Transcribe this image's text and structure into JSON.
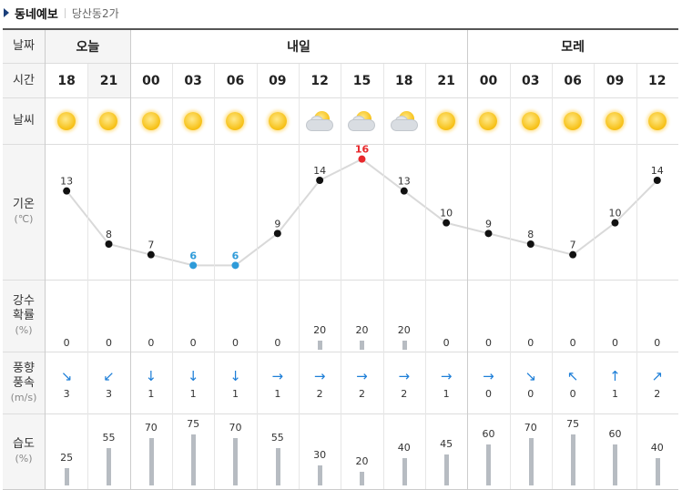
{
  "title": {
    "main": "동네예보",
    "sub": "당산동2가"
  },
  "labels": {
    "date": "날짜",
    "time": "시간",
    "weather": "날씨",
    "temp": "기온",
    "temp_unit": "(℃)",
    "precip": "강수\n확률",
    "precip_unit": "(%)",
    "wind": "풍향\n풍속",
    "wind_unit": "(m/s)",
    "humidity": "습도",
    "humidity_unit": "(%)"
  },
  "days": [
    {
      "label": "오늘",
      "span": 2
    },
    {
      "label": "내일",
      "span": 8
    },
    {
      "label": "모레",
      "span": 5
    }
  ],
  "times": [
    "18",
    "21",
    "00",
    "03",
    "06",
    "09",
    "12",
    "15",
    "18",
    "21",
    "00",
    "03",
    "06",
    "09",
    "12"
  ],
  "weather_icons": [
    "sunny",
    "sunny",
    "sunny",
    "sunny",
    "sunny",
    "sunny",
    "partly-cloudy",
    "partly-cloudy",
    "partly-cloudy",
    "sunny",
    "sunny",
    "sunny",
    "sunny",
    "sunny",
    "sunny"
  ],
  "chart_data": {
    "type": "line",
    "x": [
      "18",
      "21",
      "00",
      "03",
      "06",
      "09",
      "12",
      "15",
      "18",
      "21",
      "00",
      "03",
      "06",
      "09",
      "12"
    ],
    "series": [
      {
        "values": [
          13,
          8,
          7,
          6,
          6,
          9,
          14,
          16,
          13,
          10,
          9,
          8,
          7,
          10,
          14
        ]
      }
    ],
    "ylim": [
      5,
      17
    ],
    "max_color": "#e8282b",
    "min_color": "#2e9bd9"
  },
  "precip": [
    0,
    0,
    0,
    0,
    0,
    0,
    20,
    20,
    20,
    0,
    0,
    0,
    0,
    0,
    0
  ],
  "wind": {
    "icons": [
      "arrow-down-right",
      "arrow-down-left",
      "arrow-down",
      "arrow-down",
      "arrow-down",
      "arrow-right",
      "arrow-right",
      "arrow-right",
      "arrow-right",
      "arrow-right",
      "arrow-right",
      "arrow-down-right",
      "arrow-up-left",
      "arrow-up",
      "arrow-up-right"
    ],
    "speed": [
      3,
      3,
      1,
      1,
      1,
      1,
      2,
      2,
      2,
      1,
      0,
      0,
      0,
      1,
      2
    ],
    "color": "#1e7fd8"
  },
  "humidity": [
    25,
    55,
    70,
    75,
    70,
    55,
    30,
    20,
    40,
    45,
    60,
    70,
    75,
    60,
    40
  ]
}
